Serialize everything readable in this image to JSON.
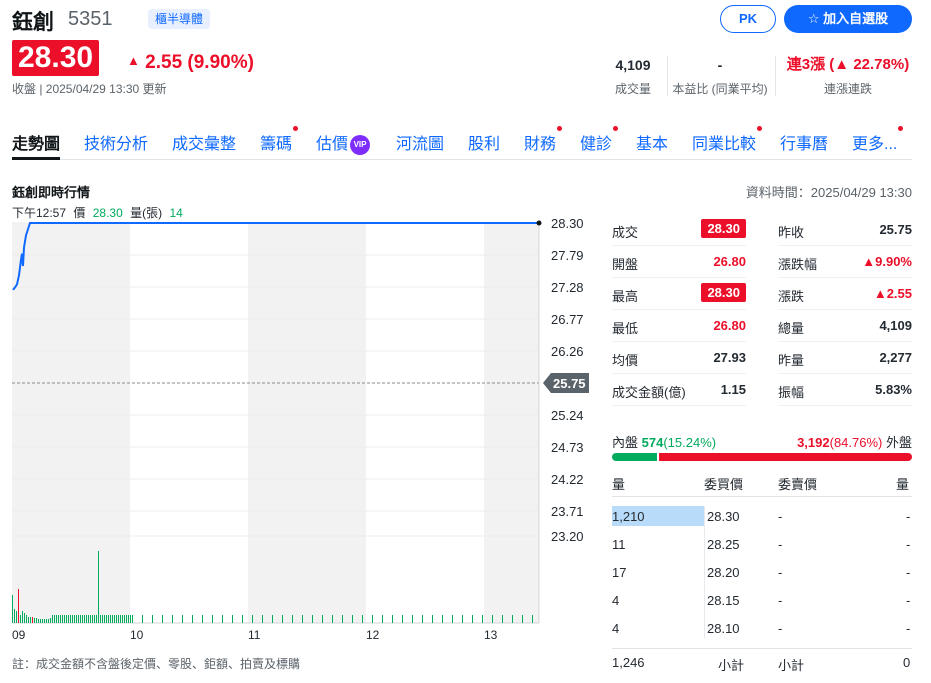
{
  "header": {
    "name": "鈺創",
    "code": "5351",
    "market": "櫃半導體",
    "pk_label": "PK",
    "watch_label": "加入自選股",
    "price": "28.30",
    "change": "2.55 (9.90%)",
    "close_info": "收盤 | 2025/04/29 13:30 更新"
  },
  "stats": [
    {
      "value": "4,109",
      "label": "成交量"
    },
    {
      "value": "-",
      "label": "本益比 (同業平均)"
    },
    {
      "value": "連3漲 (▲ 22.78%)",
      "label": "連漲連跌"
    }
  ],
  "tabs": [
    {
      "label": "走勢圖",
      "dot": false
    },
    {
      "label": "技術分析",
      "dot": false
    },
    {
      "label": "成交彙整",
      "dot": false
    },
    {
      "label": "籌碼",
      "dot": true
    },
    {
      "label": "估價",
      "dot": false,
      "vip": "VIP"
    },
    {
      "label": "河流圖",
      "dot": false
    },
    {
      "label": "股利",
      "dot": false
    },
    {
      "label": "財務",
      "dot": true
    },
    {
      "label": "健診",
      "dot": true
    },
    {
      "label": "基本",
      "dot": false
    },
    {
      "label": "同業比較",
      "dot": true
    },
    {
      "label": "行事曆",
      "dot": false
    },
    {
      "label": "更多...",
      "dot": true
    }
  ],
  "chart": {
    "title": "鈺創即時行情",
    "data_time": "資料時間：2025/04/29 13:30",
    "info_time": "下午12:57",
    "info_price_label": "價",
    "info_price": "28.30",
    "info_vol_label": "量(張)",
    "info_vol": "14",
    "footnote": "註：成交金額不含盤後定價、零股、鉅額、拍賣及標購"
  },
  "chart_data": {
    "type": "line",
    "y_ticks": [
      "28.30",
      "27.79",
      "27.28",
      "26.77",
      "26.26",
      "25.75",
      "25.24",
      "24.73",
      "24.22",
      "23.71",
      "23.20"
    ],
    "ylim": [
      23.2,
      28.3
    ],
    "reference": "25.75",
    "x_ticks": [
      "09",
      "10",
      "11",
      "12",
      "13"
    ],
    "series": [
      {
        "values": [
          27.21,
          27.25,
          27.3,
          27.45,
          27.7,
          27.8,
          27.6,
          27.9,
          28.1,
          28.3,
          28.3
        ]
      }
    ]
  },
  "quote": {
    "left": [
      {
        "label": "成交",
        "value": "28.30",
        "style": "box"
      },
      {
        "label": "開盤",
        "value": "26.80",
        "style": "red"
      },
      {
        "label": "最高",
        "value": "28.30",
        "style": "box"
      },
      {
        "label": "最低",
        "value": "26.80",
        "style": "red"
      },
      {
        "label": "均價",
        "value": "27.93",
        "style": "plain"
      },
      {
        "label": "成交金額(億)",
        "value": "1.15",
        "style": "plain"
      }
    ],
    "right": [
      {
        "label": "昨收",
        "value": "25.75",
        "style": "plain"
      },
      {
        "label": "漲跌幅",
        "value": "▲9.90%",
        "style": "red"
      },
      {
        "label": "漲跌",
        "value": "▲2.55",
        "style": "red"
      },
      {
        "label": "總量",
        "value": "4,109",
        "style": "plain"
      },
      {
        "label": "昨量",
        "value": "2,277",
        "style": "plain"
      },
      {
        "label": "振幅",
        "value": "5.83%",
        "style": "plain"
      }
    ]
  },
  "ratio": {
    "inner_label": "內盤",
    "inner_value": "574",
    "inner_pct": "(15.24%)",
    "outer_value": "3,192",
    "outer_pct": "(84.76%)",
    "outer_label": "外盤",
    "inner_fraction": 0.1524
  },
  "orderbook": {
    "headers": [
      "量",
      "委買價",
      "委賣價",
      "量"
    ],
    "rows": [
      {
        "bvol": "1,210",
        "bid": "28.30",
        "ask": "-",
        "avol": "-"
      },
      {
        "bvol": "11",
        "bid": "28.25",
        "ask": "-",
        "avol": "-"
      },
      {
        "bvol": "17",
        "bid": "28.20",
        "ask": "-",
        "avol": "-"
      },
      {
        "bvol": "4",
        "bid": "28.15",
        "ask": "-",
        "avol": "-"
      },
      {
        "bvol": "4",
        "bid": "28.10",
        "ask": "-",
        "avol": "-"
      }
    ],
    "total_bid": "1,246",
    "subtotal_label": "小計",
    "total_ask": "0"
  }
}
